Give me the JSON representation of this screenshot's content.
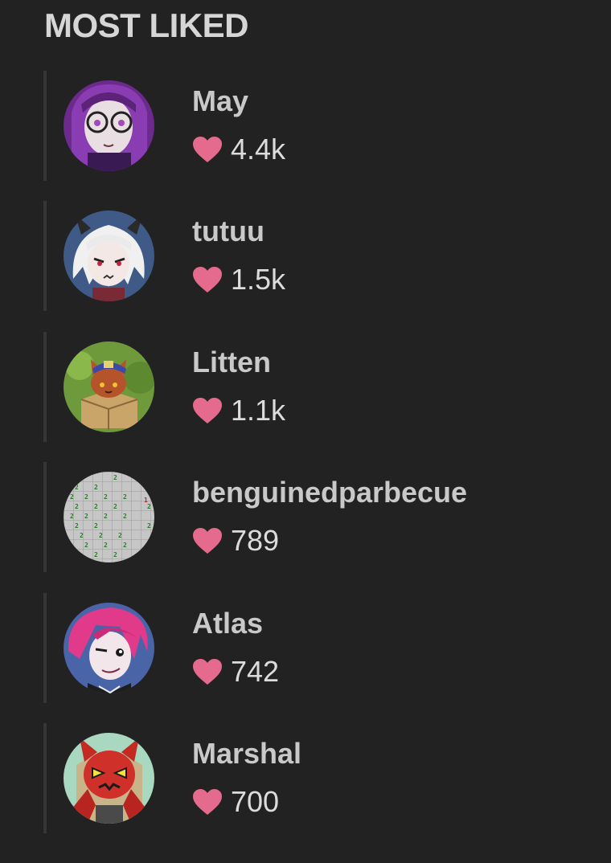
{
  "section": {
    "title": "MOST LIKED"
  },
  "colors": {
    "background": "#222222",
    "heart": "#e46b8d",
    "name_text": "#c9c9c9",
    "count_text": "#dcdcdc",
    "divider": "#363636"
  },
  "users": [
    {
      "name": "May",
      "likes": "4.4k",
      "avatar_icon": "anime-girl-glasses-avatar"
    },
    {
      "name": "tutuu",
      "likes": "1.5k",
      "avatar_icon": "white-haired-horned-avatar"
    },
    {
      "name": "Litten",
      "likes": "1.1k",
      "avatar_icon": "cat-in-box-avatar"
    },
    {
      "name": "benguinedparbecue",
      "likes": "789",
      "avatar_icon": "minesweeper-grid-avatar"
    },
    {
      "name": "Atlas",
      "likes": "742",
      "avatar_icon": "pink-haired-character-avatar"
    },
    {
      "name": "Marshal",
      "likes": "700",
      "avatar_icon": "red-demon-cat-avatar"
    }
  ]
}
